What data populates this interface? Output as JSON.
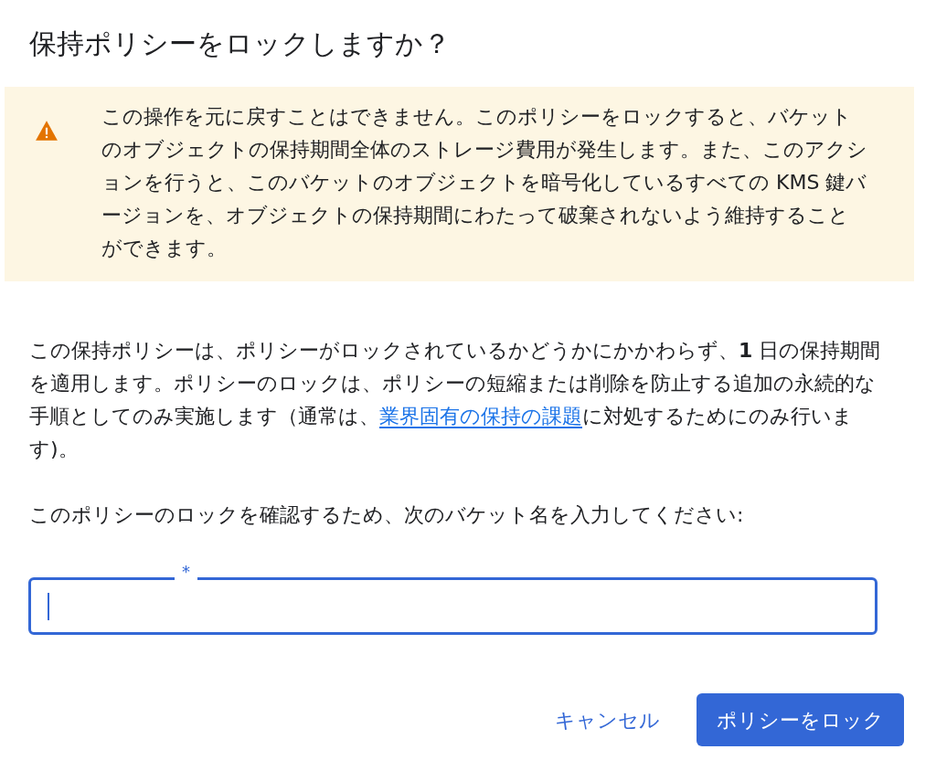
{
  "dialog": {
    "title": "保持ポリシーをロックしますか？"
  },
  "warning": {
    "text": "この操作を元に戻すことはできません。このポリシーをロックすると、バケットのオブジェクトの保持期間全体のストレージ費用が発生します。また、このアクションを行うと、このバケットのオブジェクトを暗号化しているすべての KMS 鍵バージョンを、オブジェクトの保持期間にわたって破棄されないよう維持することができます。"
  },
  "body": {
    "before": "この保持ポリシーは、ポリシーがロックされているかどうかにかかわらず、**1** 日の保持期間を適用します。ポリシーのロックは、ポリシーの短縮または削除を防止する追加の永続的な手順としてのみ実施します（通常は、",
    "link": "業界固有の保持の課題",
    "after": "に対処するためにのみ行います)。"
  },
  "prompt": "このポリシーのロックを確認するため、次のバケット名を入力してください:",
  "field": {
    "label": "*",
    "focused": true
  },
  "buttons": [
    {
      "kind": "text",
      "label": "キャンセル"
    },
    {
      "kind": "primary",
      "label": "ポリシーをロック"
    }
  ]
}
